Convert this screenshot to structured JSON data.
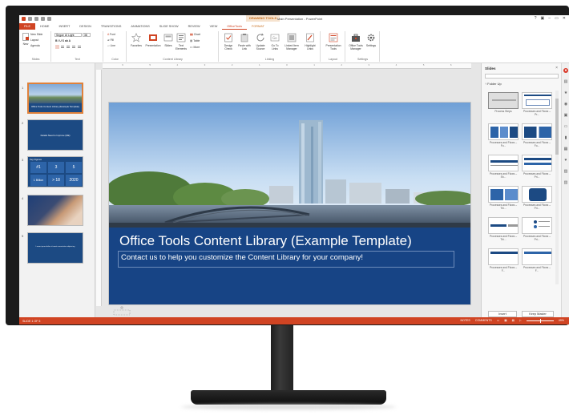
{
  "window": {
    "context_tab_group": "DRAWING TOOLS",
    "title": "Main Presentation - PowerPoint",
    "controls": [
      "?",
      "▣",
      "–",
      "▭",
      "✕"
    ]
  },
  "tabs": [
    {
      "label": "FILE"
    },
    {
      "label": "HOME"
    },
    {
      "label": "INSERT"
    },
    {
      "label": "DESIGN"
    },
    {
      "label": "TRANSITIONS"
    },
    {
      "label": "ANIMATIONS"
    },
    {
      "label": "SLIDE SHOW"
    },
    {
      "label": "REVIEW"
    },
    {
      "label": "VIEW"
    },
    {
      "label": "OfficeTools"
    },
    {
      "label": "FORMAT"
    }
  ],
  "ribbon": {
    "slides": {
      "new_label": "New",
      "new_slide": "New Slide",
      "layout": "Layout",
      "agenda": "Agenda",
      "group": "Slides"
    },
    "text": {
      "font_name": "Segoe UI Light",
      "font_size": "38",
      "format_row": "B I U S ab A",
      "group": "Text"
    },
    "color": {
      "font": "Font",
      "fill": "Fill",
      "line": "Line",
      "group": "Color"
    },
    "content_library": {
      "buttons": [
        "Favorites",
        "Presentation",
        "Slides",
        "Text Elements"
      ],
      "chart": "Chart",
      "table": "Table",
      "more": "More",
      "group": "Content Library"
    },
    "linking": {
      "buttons": [
        "Design Check",
        "Paste with Link",
        "Update Source",
        "Go To Links",
        "Linked Item Manager",
        "Highlight Links"
      ],
      "group": "Linking"
    },
    "layout": {
      "button": "Presentation Tools",
      "group": "Layout"
    },
    "settings": {
      "buttons": [
        "Office Tools Manager",
        "Settings"
      ],
      "group": "Settings"
    }
  },
  "ruler_numbers": [
    "6",
    "5",
    "4",
    "3",
    "2",
    "1",
    "0",
    "1",
    "2",
    "3",
    "4",
    "5",
    "6"
  ],
  "thumbnails": [
    {
      "num": "1",
      "text": "Office Tools Content Library (Example Template)"
    },
    {
      "num": "2",
      "text": "Details Need to Improve (ME)"
    },
    {
      "num": "3",
      "text": "Key Figures",
      "figures": [
        "#1",
        "3",
        "5",
        "1 Billion",
        "> 18",
        "2020"
      ]
    },
    {
      "num": "4",
      "text": ""
    },
    {
      "num": "5",
      "text": "Lorem ipsum dolor sit amet consectetur adipiscing"
    }
  ],
  "slide": {
    "title": "Office Tools Content Library (Example Template)",
    "subtitle": "Contact us to help you customize the Content Library for your company!"
  },
  "pane": {
    "title": "Slides",
    "folder_up": "Folder Up",
    "cards": [
      {
        "caption": "Process Steps"
      },
      {
        "caption": "Processes and Flows – Pr..."
      },
      {
        "caption": "Processes and Flows – Fo..."
      },
      {
        "caption": "Processes and Flows – Fo..."
      },
      {
        "caption": "Processes and Flows – Sh..."
      },
      {
        "caption": "Processes and Flows – Pri..."
      },
      {
        "caption": "Processes and Flows – Thi..."
      },
      {
        "caption": "Processes and Flows – Pri..."
      },
      {
        "caption": "Processes and Flows – Thi..."
      },
      {
        "caption": "Processes and Flows – Pri..."
      },
      {
        "caption": "Processes and Flows – F..."
      },
      {
        "caption": "Processes and Flows – F..."
      }
    ],
    "insert": "Insert",
    "keep_master": "Keep Master"
  },
  "status": {
    "slide_counter": "SLIDE 1 OF 5",
    "notes": "NOTES",
    "comments": "COMMENTS",
    "zoom": "49%"
  },
  "colors": {
    "accent": "#d04423",
    "slide_blue": "#174485"
  }
}
